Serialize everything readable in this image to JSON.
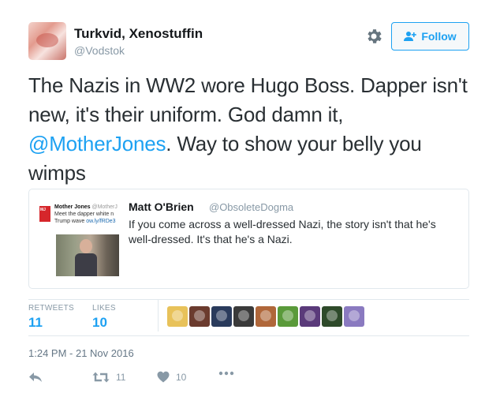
{
  "author": {
    "name": "Turkvid, Xenostuffin",
    "handle": "@Vodstok"
  },
  "follow_button": {
    "label": "Follow",
    "icon": "add-user-icon"
  },
  "settings_icon": "gear-icon",
  "tweet": {
    "text_before": "The Nazis in WW2 wore Hugo Boss. Dapper isn't new, it's their uniform. God damn it, ",
    "mention": "@MotherJones",
    "text_after": ". Way to show your belly you wimps"
  },
  "quoted_tweet": {
    "name": "Matt O'Brien",
    "handle": "@ObsoleteDogma",
    "text": "If you come across a well-dressed Nazi, the story isn't that he's well-dressed. It's that he's a Nazi.",
    "thumbnail": {
      "logo_text": "Mother Jones",
      "source_name": "Mother Jones",
      "source_handle": "@MotherJ",
      "line1": "Meet the dapper white n",
      "line2_prefix": "Trump wave ",
      "line2_link": "ow.ly/fRDe3"
    }
  },
  "stats": {
    "retweets_label": "RETWEETS",
    "retweets_value": "11",
    "likes_label": "LIKES",
    "likes_value": "10"
  },
  "liker_colors": [
    "#e8c25a",
    "#6b3b2e",
    "#2a3b5c",
    "#3a3a3a",
    "#b0673a",
    "#5a9a3a",
    "#5a3a7a",
    "#2e4a2a",
    "#8a7ac0"
  ],
  "timestamp": "1:24 PM - 21 Nov 2016",
  "actions": {
    "reply_icon": "reply-icon",
    "retweet_icon": "retweet-icon",
    "retweet_count": "11",
    "like_icon": "heart-icon",
    "like_count": "10",
    "more_icon": "more-dots-icon"
  },
  "colors": {
    "accent": "#1da1f2",
    "muted": "#8899a6",
    "border": "#e1e8ed"
  }
}
